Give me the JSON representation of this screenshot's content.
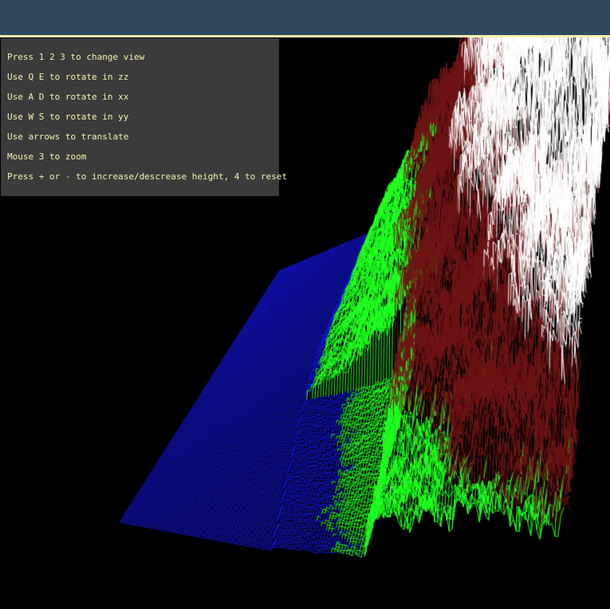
{
  "window": {
    "title": ""
  },
  "help": {
    "lines": [
      "Press 1 2 3 to change view",
      "Use Q E to rotate in zz",
      "Use A D to rotate in xx",
      "Use W S to rotate in yy",
      "Use arrows to translate",
      "Mouse 3 to zoom",
      "Press + or - to increase/descrease height, 4 to reset"
    ]
  },
  "terrain": {
    "render_mode": "wireframe-heightmap",
    "colors": {
      "background": "#000000",
      "water": "#1414d2",
      "lowland": "#20ff20",
      "highland": "#6e1414",
      "peak": "#ffffff"
    }
  }
}
